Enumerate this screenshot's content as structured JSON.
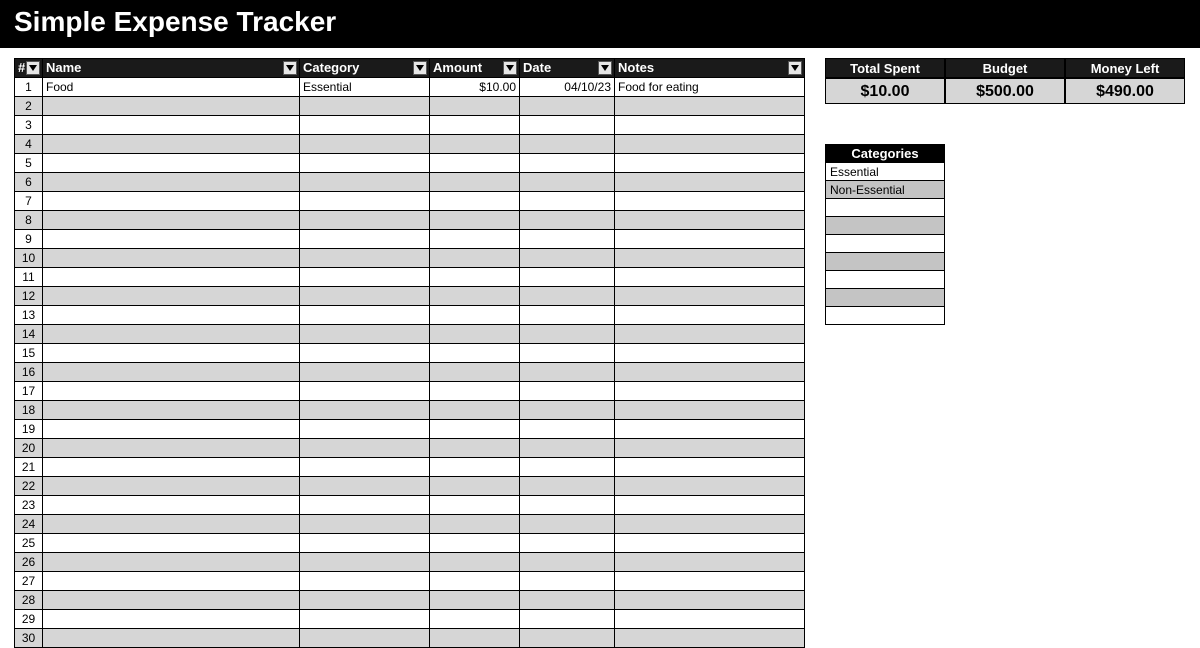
{
  "title": "Simple Expense Tracker",
  "columns": {
    "idx": "#",
    "name": "Name",
    "category": "Category",
    "amount": "Amount",
    "date": "Date",
    "notes": "Notes"
  },
  "rows": [
    {
      "idx": "1",
      "name": "Food",
      "category": "Essential",
      "amount": "$10.00",
      "date": "04/10/23",
      "notes": "Food for eating"
    },
    {
      "idx": "2",
      "name": "",
      "category": "",
      "amount": "",
      "date": "",
      "notes": ""
    },
    {
      "idx": "3",
      "name": "",
      "category": "",
      "amount": "",
      "date": "",
      "notes": ""
    },
    {
      "idx": "4",
      "name": "",
      "category": "",
      "amount": "",
      "date": "",
      "notes": ""
    },
    {
      "idx": "5",
      "name": "",
      "category": "",
      "amount": "",
      "date": "",
      "notes": ""
    },
    {
      "idx": "6",
      "name": "",
      "category": "",
      "amount": "",
      "date": "",
      "notes": ""
    },
    {
      "idx": "7",
      "name": "",
      "category": "",
      "amount": "",
      "date": "",
      "notes": ""
    },
    {
      "idx": "8",
      "name": "",
      "category": "",
      "amount": "",
      "date": "",
      "notes": ""
    },
    {
      "idx": "9",
      "name": "",
      "category": "",
      "amount": "",
      "date": "",
      "notes": ""
    },
    {
      "idx": "10",
      "name": "",
      "category": "",
      "amount": "",
      "date": "",
      "notes": ""
    },
    {
      "idx": "11",
      "name": "",
      "category": "",
      "amount": "",
      "date": "",
      "notes": ""
    },
    {
      "idx": "12",
      "name": "",
      "category": "",
      "amount": "",
      "date": "",
      "notes": ""
    },
    {
      "idx": "13",
      "name": "",
      "category": "",
      "amount": "",
      "date": "",
      "notes": ""
    },
    {
      "idx": "14",
      "name": "",
      "category": "",
      "amount": "",
      "date": "",
      "notes": ""
    },
    {
      "idx": "15",
      "name": "",
      "category": "",
      "amount": "",
      "date": "",
      "notes": ""
    },
    {
      "idx": "16",
      "name": "",
      "category": "",
      "amount": "",
      "date": "",
      "notes": ""
    },
    {
      "idx": "17",
      "name": "",
      "category": "",
      "amount": "",
      "date": "",
      "notes": ""
    },
    {
      "idx": "18",
      "name": "",
      "category": "",
      "amount": "",
      "date": "",
      "notes": ""
    },
    {
      "idx": "19",
      "name": "",
      "category": "",
      "amount": "",
      "date": "",
      "notes": ""
    },
    {
      "idx": "20",
      "name": "",
      "category": "",
      "amount": "",
      "date": "",
      "notes": ""
    },
    {
      "idx": "21",
      "name": "",
      "category": "",
      "amount": "",
      "date": "",
      "notes": ""
    },
    {
      "idx": "22",
      "name": "",
      "category": "",
      "amount": "",
      "date": "",
      "notes": ""
    },
    {
      "idx": "23",
      "name": "",
      "category": "",
      "amount": "",
      "date": "",
      "notes": ""
    },
    {
      "idx": "24",
      "name": "",
      "category": "",
      "amount": "",
      "date": "",
      "notes": ""
    },
    {
      "idx": "25",
      "name": "",
      "category": "",
      "amount": "",
      "date": "",
      "notes": ""
    },
    {
      "idx": "26",
      "name": "",
      "category": "",
      "amount": "",
      "date": "",
      "notes": ""
    },
    {
      "idx": "27",
      "name": "",
      "category": "",
      "amount": "",
      "date": "",
      "notes": ""
    },
    {
      "idx": "28",
      "name": "",
      "category": "",
      "amount": "",
      "date": "",
      "notes": ""
    },
    {
      "idx": "29",
      "name": "",
      "category": "",
      "amount": "",
      "date": "",
      "notes": ""
    },
    {
      "idx": "30",
      "name": "",
      "category": "",
      "amount": "",
      "date": "",
      "notes": ""
    }
  ],
  "summary": {
    "total_spent_label": "Total Spent",
    "budget_label": "Budget",
    "money_left_label": "Money Left",
    "total_spent": "$10.00",
    "budget": "$500.00",
    "money_left": "$490.00"
  },
  "categories_header": "Categories",
  "categories": [
    "Essential",
    "Non-Essential",
    "",
    "",
    "",
    "",
    "",
    "",
    ""
  ]
}
